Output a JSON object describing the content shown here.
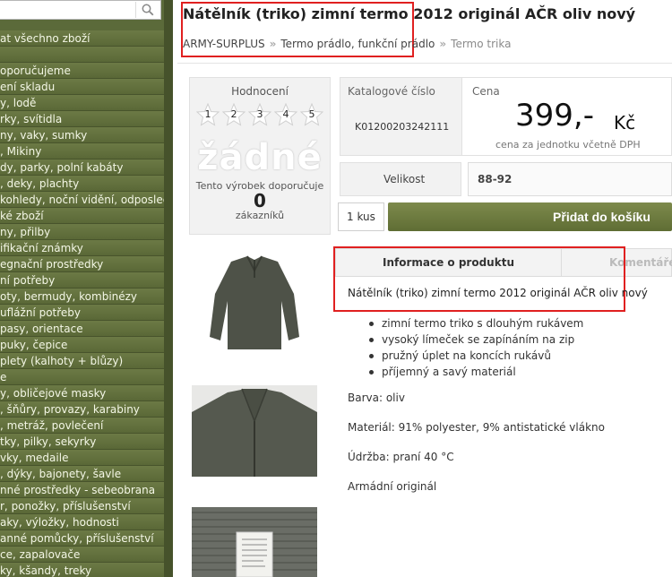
{
  "sidebar": {
    "search": {
      "value": "",
      "placeholder": ""
    },
    "categories": [
      "at všechno zboží",
      "",
      "oporučujeme",
      "ení skladu",
      "y, lodě",
      "rky, svítidla",
      "ny, vaky, sumky",
      ", Mikiny",
      "dy, parky, polní kabáty",
      ", deky, plachty",
      "kohledy, noční vidění, odposlech",
      "ké zboží",
      "ny, přilby",
      "ifikační známky",
      "egnační prostředky",
      "ní potřeby",
      "oty, bermudy, kombinézy",
      "uflážní potřeby",
      "pasy, orientace",
      "puky, čepice",
      "plety (kalhoty + blůzy)",
      "e",
      "y, obličejové masky",
      ", šňůry, provazy, karabiny",
      ", metráž, povlečení",
      "tky, pilky, sekyrky",
      "vky, medaile",
      ", dýky, bajonety, šavle",
      "nné prostředky - sebeobrana",
      "r, ponožky, příslušenství",
      "aky, výložky, hodnosti",
      "anné pomůcky, příslušenství",
      "ce, zapalovače",
      "ky, kšandy, treky"
    ]
  },
  "product": {
    "title": "Nátělník (triko) zimní termo 2012 originál AČR oliv nový",
    "breadcrumb": [
      "ARMY-SURPLUS",
      "Termo prádlo, funkční prádlo",
      "Termo trika"
    ],
    "rating": {
      "label": "Hodnocení",
      "stars": [
        "1",
        "2",
        "3",
        "4",
        "5"
      ],
      "none_text": "žádné",
      "recommend_text": "Tento výrobek doporučuje",
      "count": "0",
      "customers_label": "zákazníků"
    },
    "catalog": {
      "label": "Katalogové číslo",
      "value": "K01200203242111"
    },
    "price": {
      "label": "Cena",
      "amount": "399,-",
      "currency": "Kč",
      "note": "cena za jednotku včetně DPH"
    },
    "size": {
      "label": "Velikost",
      "value": "88-92"
    },
    "quantity": "1 kus",
    "add_to_cart": "Přidat do košíku",
    "tabs": [
      "Informace o produktu",
      "Komentáře k"
    ],
    "description_title": "Nátělník (triko) zimní termo 2012 originál AČR oliv nový",
    "features": [
      "zimní termo triko s dlouhým rukávem",
      "vysoký límeček se zapínáním na zip",
      "pružný úplet na koncích rukávů",
      "příjemný a savý materiál"
    ],
    "color": "Barva: oliv",
    "material": "Materiál: 91% polyester, 9% antistatické vlákno",
    "care": "Údržba: praní 40 °C",
    "origin": "Armádní originál"
  },
  "colors": {
    "accent": "#6b7a3e",
    "highlight": "#e02020"
  }
}
